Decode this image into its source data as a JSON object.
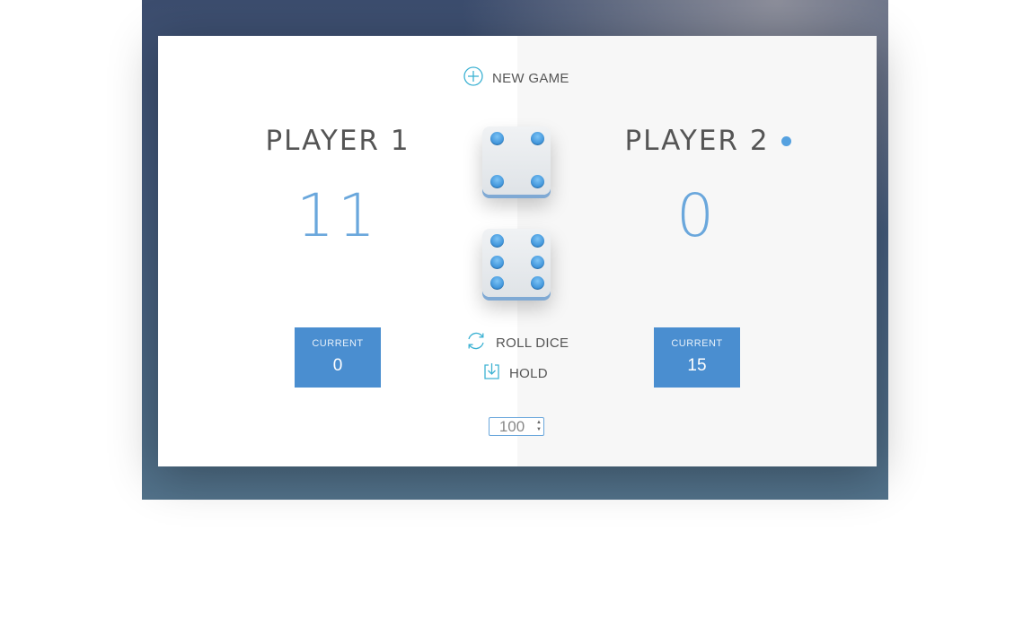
{
  "controls": {
    "new_game_label": "NEW GAME",
    "roll_dice_label": "ROLL DICE",
    "hold_label": "HOLD"
  },
  "players": [
    {
      "name": "PLAYER 1",
      "score": "11",
      "current_label": "CURRENT",
      "current_value": "0",
      "active": false
    },
    {
      "name": "PLAYER 2",
      "score": "0",
      "current_label": "CURRENT",
      "current_value": "15",
      "active": true
    }
  ],
  "dice": [
    {
      "value": 4
    },
    {
      "value": 6
    }
  ],
  "winning_score": {
    "value": "100"
  },
  "colors": {
    "accent": "#4a8ed0",
    "score_text": "#6aa7dc",
    "active_dot": "#55a1e0",
    "icon": "#3db2d3"
  },
  "icons": {
    "new_game": "plus-circle-icon",
    "roll_dice": "refresh-icon",
    "hold": "download-icon"
  }
}
